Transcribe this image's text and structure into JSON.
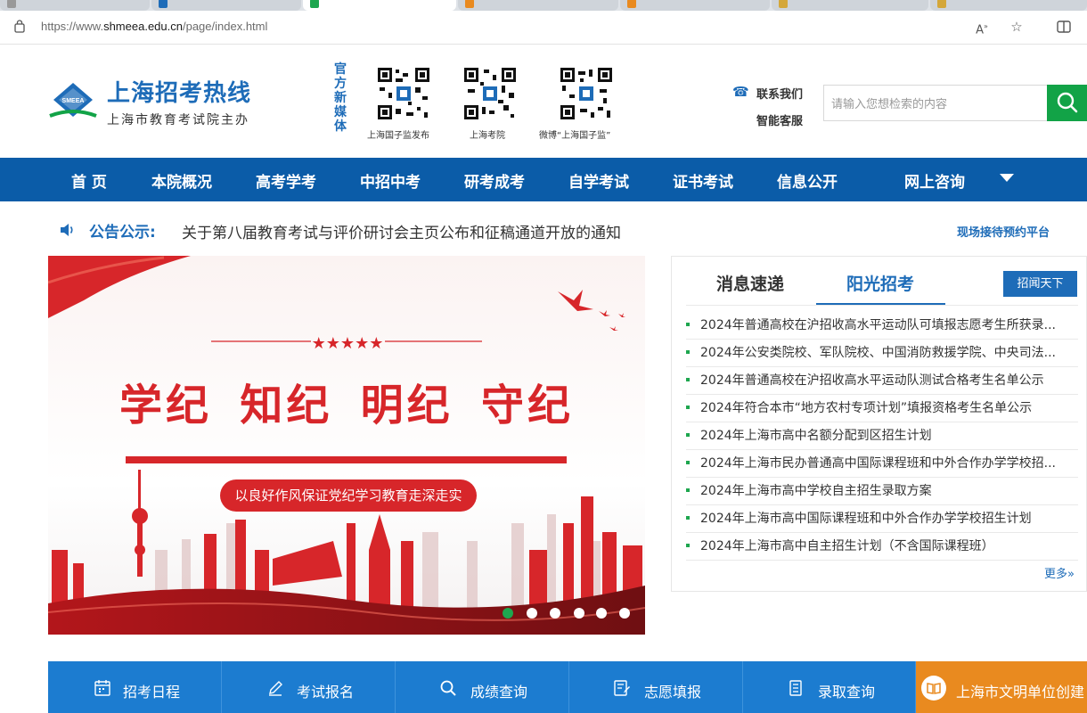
{
  "browser": {
    "url_prefix": "https://www.",
    "url_domain": "shmeea.edu.cn",
    "url_path": "/page/index.html"
  },
  "header": {
    "site_title": "上海招考热线",
    "site_subtitle": "上海市教育考试院主办",
    "logo_text": "SMEEA",
    "media_label": [
      "官",
      "方",
      "新",
      "媒",
      "体"
    ],
    "qr_captions": [
      "上海国子监发布",
      "上海考院",
      "微博“上海国子监”"
    ],
    "contact_label": "联系我们",
    "smart_service_label": "智能客服",
    "search_placeholder": "请输入您想检索的内容"
  },
  "nav": {
    "items": [
      "首 页",
      "本院概况",
      "高考学考",
      "中招中考",
      "研考成考",
      "自学考试",
      "证书考试",
      "信息公开",
      "网上咨询"
    ]
  },
  "notice": {
    "label": "公告公示:",
    "text": "关于第八届教育考试与评价研讨会主页公布和征稿通道开放的通知",
    "reception_link": "现场接待预约平台"
  },
  "banner": {
    "title": "学纪 知纪 明纪 守纪",
    "subtitle": "以良好作风保证党纪学习教育走深走实",
    "active_slide": 1,
    "slide_count": 6
  },
  "news_panel": {
    "tabs": [
      "消息速递",
      "阳光招考"
    ],
    "active_tab": 1,
    "badge": "招闻天下",
    "items": [
      "2024年普通高校在沪招收高水平运动队可填报志愿考生所获录...",
      "2024年公安类院校、军队院校、中国消防救援学院、中央司法...",
      "2024年普通高校在沪招收高水平运动队测试合格考生名单公示",
      "2024年符合本市“地方农村专项计划”填报资格考生名单公示",
      "2024年上海市高中名额分配到区招生计划",
      "2024年上海市民办普通高中国际课程班和中外合作办学学校招...",
      "2024年上海市高中学校自主招生录取方案",
      "2024年上海市高中国际课程班和中外合作办学学校招生计划",
      "2024年上海市高中自主招生计划（不含国际课程班）"
    ],
    "more": "更多»"
  },
  "quick_links": [
    {
      "label": "招考日程",
      "icon": "calendar-icon"
    },
    {
      "label": "考试报名",
      "icon": "pen-icon"
    },
    {
      "label": "成绩查询",
      "icon": "search-icon"
    },
    {
      "label": "志愿填报",
      "icon": "form-edit-icon"
    },
    {
      "label": "录取查询",
      "icon": "document-icon"
    },
    {
      "label": "上海市文明单位创建",
      "icon": "book-icon"
    }
  ],
  "colors": {
    "brand_blue": "#1e6cb8",
    "nav_blue": "#0b5ca8",
    "green": "#12a347",
    "banner_red": "#d7262a",
    "quick_blue": "#1c7cd0",
    "orange": "#e98a1f"
  }
}
